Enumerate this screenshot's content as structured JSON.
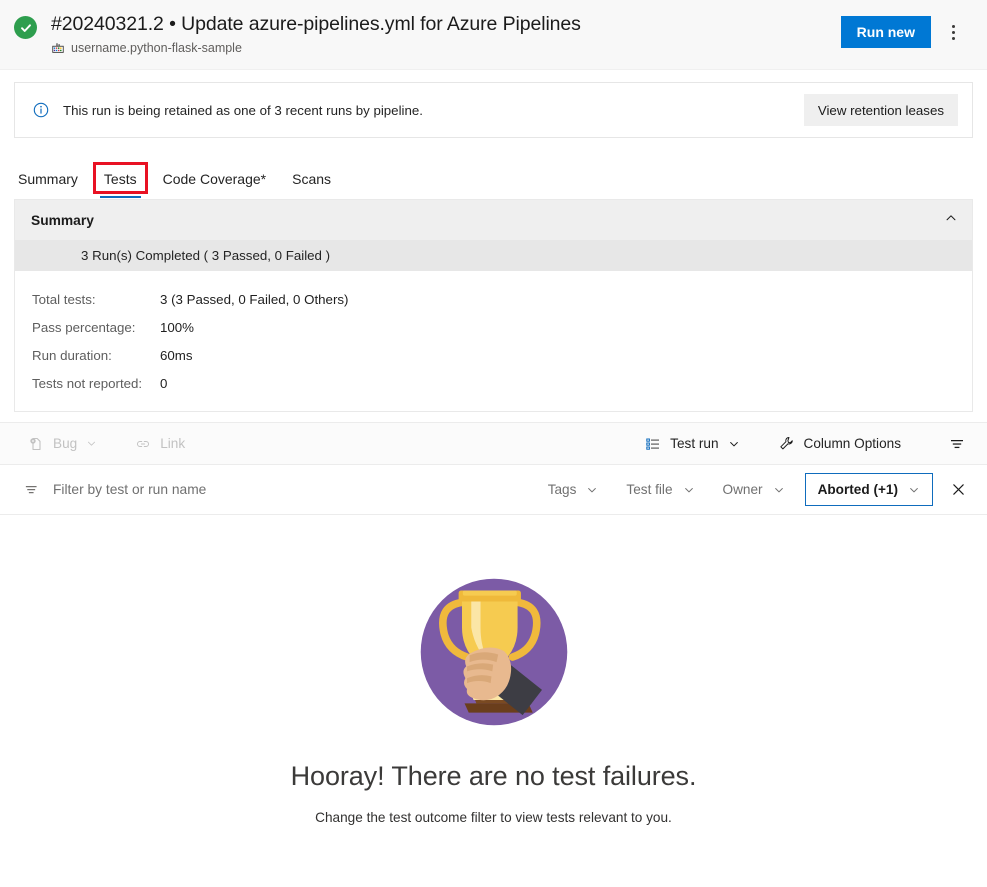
{
  "header": {
    "status_icon": "success-check-icon",
    "title": "#20240321.2 • Update azure-pipelines.yml for Azure Pipelines",
    "pipeline_icon": "pipeline-icon",
    "pipeline_name": "username.python-flask-sample",
    "run_new_label": "Run new",
    "more_actions_icon": "more-actions-kebab-icon",
    "accent_color": "#0078d4",
    "success_color": "#2e9e4e"
  },
  "banner": {
    "icon": "info-icon",
    "message": "This run is being retained as one of 3 recent runs by pipeline.",
    "action_label": "View retention leases"
  },
  "tabs": [
    {
      "label": "Summary",
      "selected": false
    },
    {
      "label": "Tests",
      "selected": true,
      "annotated": true
    },
    {
      "label": "Code Coverage*",
      "selected": false
    },
    {
      "label": "Scans",
      "selected": false
    }
  ],
  "annotation_color": "#e81123",
  "summary": {
    "heading": "Summary",
    "collapse_icon": "chevron-up-icon",
    "runs_line": "3 Run(s) Completed ( 3 Passed, 0 Failed )",
    "stats": [
      {
        "label": "Total tests:",
        "value": "3 (3 Passed, 0 Failed, 0 Others)"
      },
      {
        "label": "Pass percentage:",
        "value": "100%"
      },
      {
        "label": "Run duration:",
        "value": "60ms"
      },
      {
        "label": "Tests not reported:",
        "value": "0"
      }
    ]
  },
  "grid_toolbar": {
    "bug_label": "Bug",
    "bug_icon": "bug-icon",
    "bug_chevron_icon": "chevron-down-icon",
    "link_label": "Link",
    "link_icon": "link-icon",
    "grouping_label": "Test run",
    "grouping_icon": "group-list-icon",
    "grouping_chevron_icon": "chevron-down-icon",
    "column_options_label": "Column Options",
    "column_options_icon": "wrench-icon",
    "filter_toggle_icon": "filter-icon"
  },
  "filter_bar": {
    "filter_icon": "filter-icon",
    "search_placeholder": "Filter by test or run name",
    "search_value": "",
    "pills": [
      {
        "label": "Tags",
        "active": false,
        "chevron_icon": "chevron-down-icon"
      },
      {
        "label": "Test file",
        "active": false,
        "chevron_icon": "chevron-down-icon"
      },
      {
        "label": "Owner",
        "active": false,
        "chevron_icon": "chevron-down-icon"
      },
      {
        "label": "Aborted (+1)",
        "active": true,
        "chevron_icon": "chevron-down-icon"
      }
    ],
    "close_icon": "close-icon",
    "active_border_color": "#0f6cbd"
  },
  "empty_state": {
    "illustration": "trophy-held-in-hand-illustration",
    "title": "Hooray! There are no test failures.",
    "subtitle": "Change the test outcome filter to view tests relevant to you."
  }
}
